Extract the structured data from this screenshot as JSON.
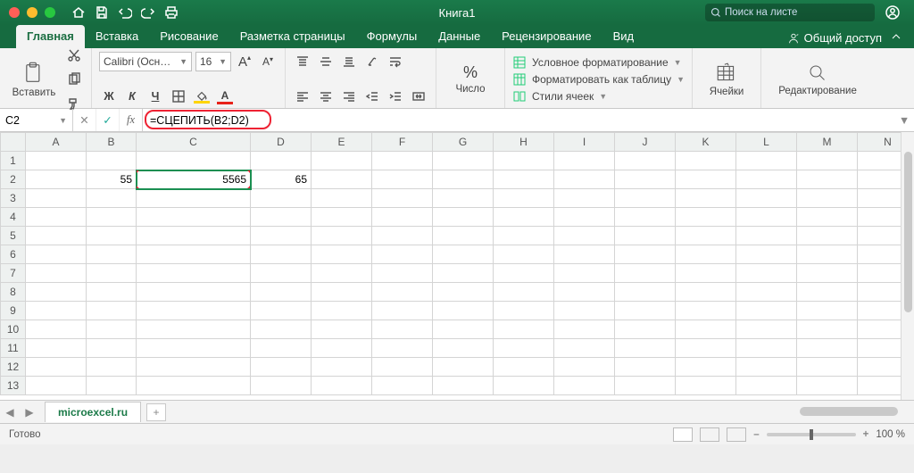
{
  "titlebar": {
    "title": "Книга1",
    "search_placeholder": "Поиск на листе"
  },
  "tabs": {
    "home": "Главная",
    "insert": "Вставка",
    "draw": "Рисование",
    "pagelayout": "Разметка страницы",
    "formulas": "Формулы",
    "data": "Данные",
    "review": "Рецензирование",
    "view": "Вид",
    "share": "Общий доступ"
  },
  "ribbon": {
    "paste": "Вставить",
    "font_name": "Calibri (Осн…",
    "font_size": "16",
    "bold": "Ж",
    "italic": "К",
    "underline": "Ч",
    "font_letter": "А",
    "number_group": "Число",
    "percent": "%",
    "cond_format": "Условное форматирование",
    "format_table": "Форматировать как таблицу",
    "cell_styles": "Стили ячеек",
    "cells": "Ячейки",
    "editing": "Редактирование"
  },
  "formula_bar": {
    "cell_ref": "C2",
    "cancel": "✕",
    "accept": "✓",
    "fx": "fx",
    "formula": "=СЦЕПИТЬ(B2;D2)"
  },
  "columns": [
    "A",
    "B",
    "C",
    "D",
    "E",
    "F",
    "G",
    "H",
    "I",
    "J",
    "K",
    "L",
    "M",
    "N"
  ],
  "rows": [
    "1",
    "2",
    "3",
    "4",
    "5",
    "6",
    "7",
    "8",
    "9",
    "10",
    "11",
    "12",
    "13"
  ],
  "cells": {
    "B2": "55",
    "C2": "5565",
    "D2": "65"
  },
  "sheet_tabs": {
    "name": "microexcel.ru",
    "add": "+"
  },
  "statusbar": {
    "ready": "Готово",
    "zoom": "100 %",
    "minus": "–",
    "plus": "+"
  }
}
